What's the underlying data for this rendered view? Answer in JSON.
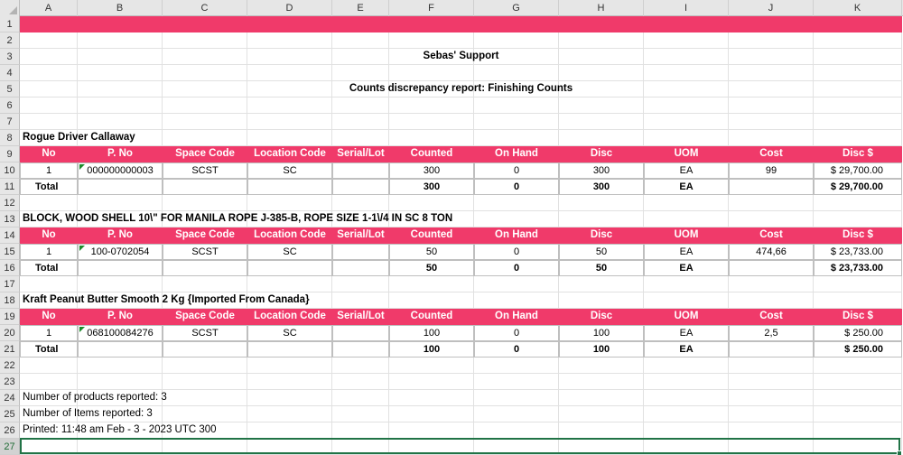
{
  "columns": [
    "A",
    "B",
    "C",
    "D",
    "E",
    "F",
    "G",
    "H",
    "I",
    "J",
    "K"
  ],
  "row_numbers": [
    "1",
    "2",
    "3",
    "4",
    "5",
    "6",
    "7",
    "8",
    "9",
    "10",
    "11",
    "12",
    "13",
    "14",
    "15",
    "16",
    "17",
    "18",
    "19",
    "20",
    "21",
    "22",
    "23",
    "24",
    "25",
    "26",
    "27"
  ],
  "title": "Sebas' Support",
  "report_title": "Counts discrepancy report: Finishing Counts",
  "table_headers": [
    "No",
    "P. No",
    "Space Code",
    "Location Code",
    "Serial/Lot",
    "Counted",
    "On Hand",
    "Disc",
    "UOM",
    "Cost",
    "Disc $"
  ],
  "sections": [
    {
      "product": "Rogue Driver Callaway",
      "item": {
        "no": "1",
        "pno": "000000000003",
        "space": "SCST",
        "location": "SC",
        "serial": "",
        "counted": "300",
        "onhand": "0",
        "disc": "300",
        "uom": "EA",
        "cost": "99",
        "disc_amt": "$ 29,700.00"
      },
      "total": {
        "label": "Total",
        "counted": "300",
        "onhand": "0",
        "disc": "300",
        "uom": "EA",
        "disc_amt": "$ 29,700.00"
      }
    },
    {
      "product": "BLOCK, WOOD SHELL 10\\\" FOR MANILA ROPE J-385-B, ROPE SIZE 1-1\\/4 IN SC 8 TON",
      "item": {
        "no": "1",
        "pno": "100-0702054",
        "space": "SCST",
        "location": "SC",
        "serial": "",
        "counted": "50",
        "onhand": "0",
        "disc": "50",
        "uom": "EA",
        "cost": "474,66",
        "disc_amt": "$ 23,733.00"
      },
      "total": {
        "label": "Total",
        "counted": "50",
        "onhand": "0",
        "disc": "50",
        "uom": "EA",
        "disc_amt": "$ 23,733.00"
      }
    },
    {
      "product": "Kraft Peanut Butter Smooth 2 Kg {Imported From Canada}",
      "item": {
        "no": "1",
        "pno": "068100084276",
        "space": "SCST",
        "location": "SC",
        "serial": "",
        "counted": "100",
        "onhand": "0",
        "disc": "100",
        "uom": "EA",
        "cost": "2,5",
        "disc_amt": "$ 250.00"
      },
      "total": {
        "label": "Total",
        "counted": "100",
        "onhand": "0",
        "disc": "100",
        "uom": "EA",
        "disc_amt": "$ 250.00"
      }
    }
  ],
  "footer": {
    "products_reported": "Number of products reported: 3",
    "items_reported": "Number of Items reported: 3",
    "printed": "Printed: 11:48 am Feb - 3 - 2023 UTC 300"
  },
  "colors": {
    "accent": "#f03a6a",
    "selection": "#217346",
    "error_indicator": "#1b8b2b"
  }
}
